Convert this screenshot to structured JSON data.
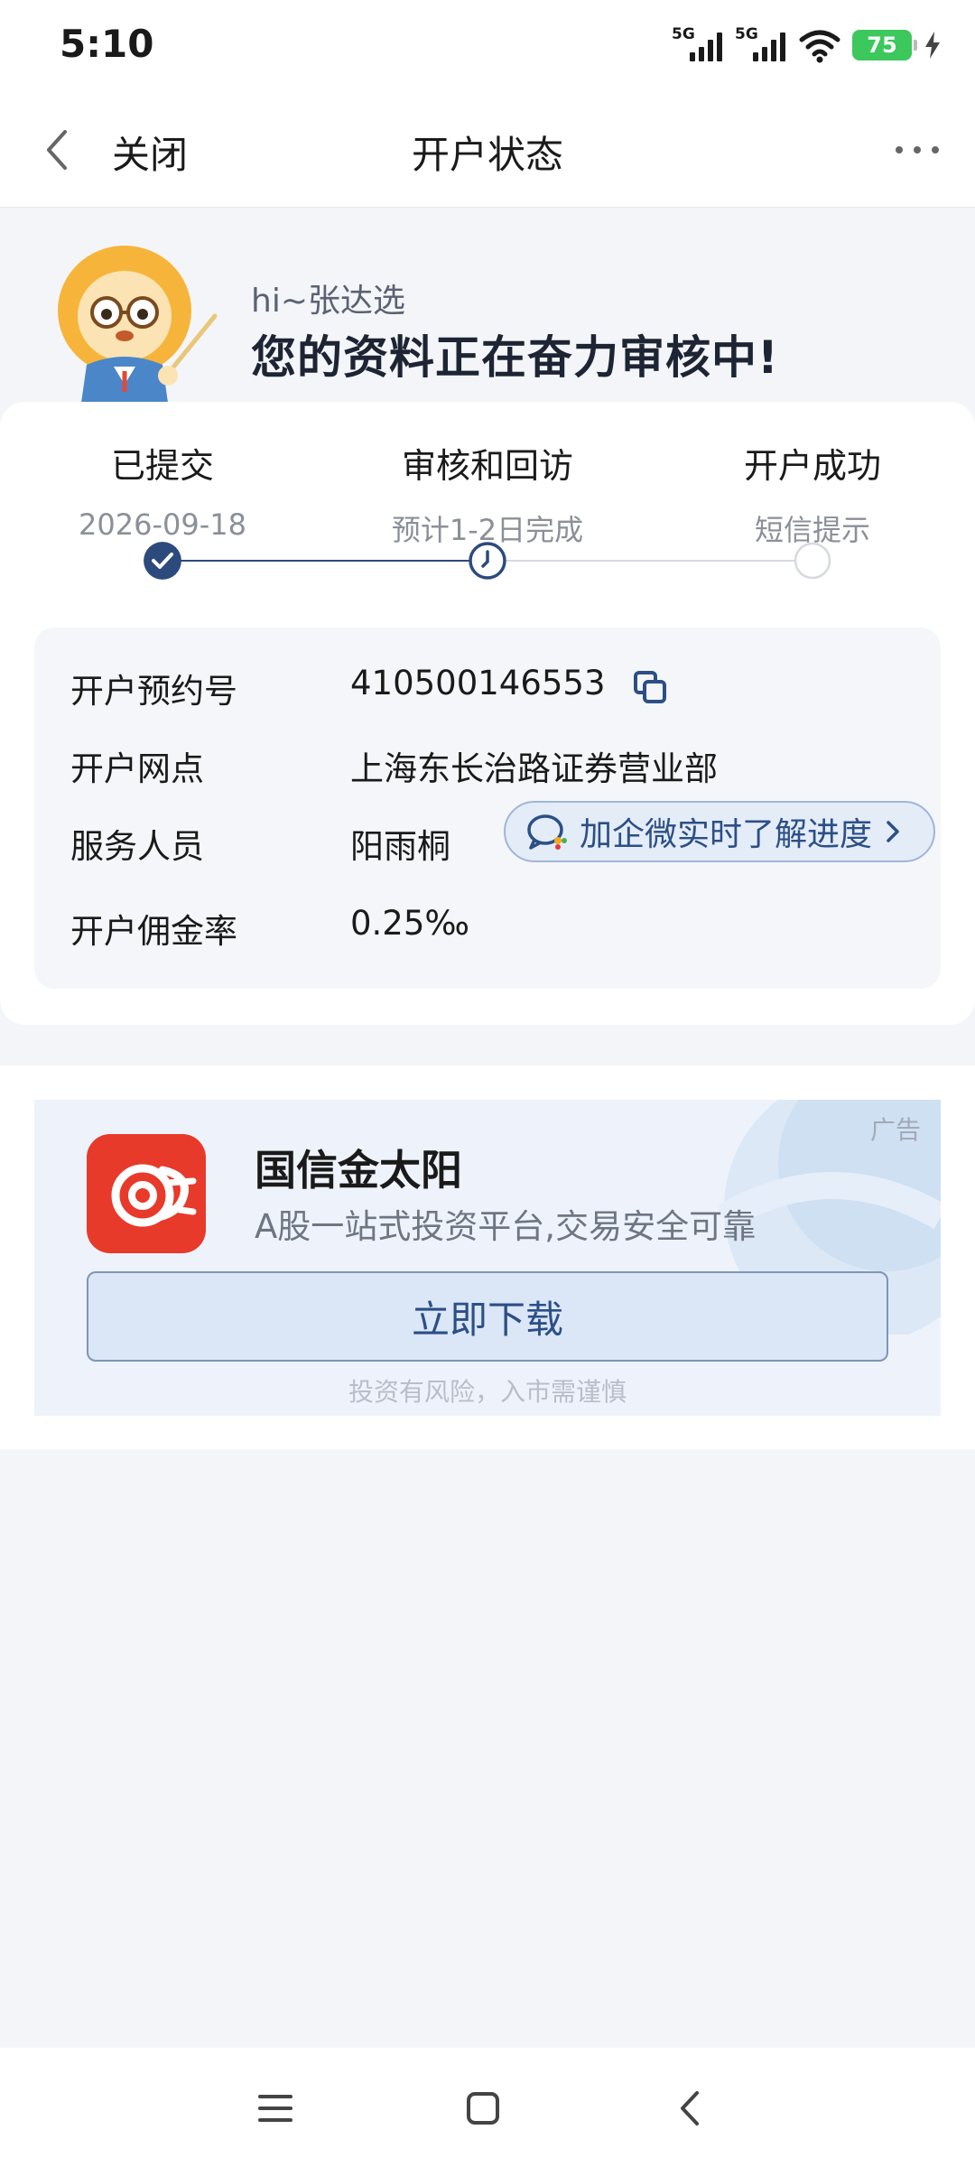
{
  "status_bar": {
    "time": "5:10",
    "signal1_label": "5G",
    "signal2_label": "5G",
    "battery_level": "75"
  },
  "nav": {
    "close_label": "关闭",
    "title": "开户状态"
  },
  "greeting": {
    "hi_text": "hi~张达选",
    "main_text": "您的资料正在奋力审核中!"
  },
  "steps": [
    {
      "title": "已提交",
      "sub": "2026-09-18",
      "state": "done"
    },
    {
      "title": "审核和回访",
      "sub": "预计1-2日完成",
      "state": "current"
    },
    {
      "title": "开户成功",
      "sub": "短信提示",
      "state": "pending"
    }
  ],
  "info": {
    "reservation_label": "开户预约号",
    "reservation_value": "410500146553",
    "branch_label": "开户网点",
    "branch_value": "上海东长治路证券营业部",
    "staff_label": "服务人员",
    "staff_value": "阳雨桐",
    "wechat_button": "加企微实时了解进度",
    "commission_label": "开户佣金率",
    "commission_value": "0.25‰"
  },
  "ad": {
    "tag": "广告",
    "app_name": "国信金太阳",
    "app_desc": "A股一站式投资平台,交易安全可靠",
    "download_label": "立即下载",
    "risk_note": "投资有风险，入市需谨慎"
  },
  "colors": {
    "accent": "#2b4f86",
    "done": "#2c4a7c",
    "battery": "#3cc85c",
    "app_icon": "#e83a2a"
  }
}
